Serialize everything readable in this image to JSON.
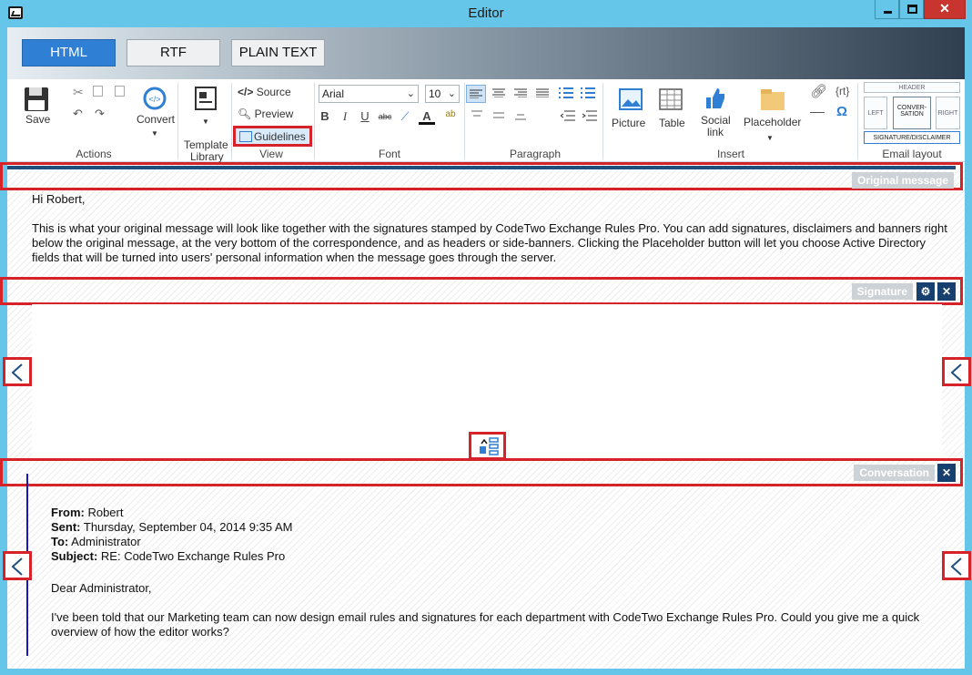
{
  "window": {
    "title": "Editor",
    "minimize_glyph": "",
    "maximize_glyph": "",
    "close_glyph": "✕"
  },
  "format_tabs": [
    {
      "label": "HTML",
      "active": true
    },
    {
      "label": "RTF",
      "active": false
    },
    {
      "label": "PLAIN TEXT",
      "active": false
    }
  ],
  "ribbon": {
    "actions": {
      "save": "Save",
      "convert": "Convert",
      "label": "Actions"
    },
    "template": {
      "label_line1": "Template",
      "label_line2": "Library"
    },
    "view": {
      "source": "Source",
      "preview": "Preview",
      "guidelines": "Guidelines",
      "label": "View"
    },
    "font": {
      "family": "Arial",
      "size": "10",
      "label": "Font"
    },
    "paragraph": {
      "label": "Paragraph"
    },
    "insert": {
      "picture": "Picture",
      "table": "Table",
      "social_line1": "Social",
      "social_line2": "link",
      "placeholder": "Placeholder",
      "rt": "{rt}",
      "omega": "Ω",
      "label": "Insert"
    },
    "email_layout": {
      "header": "HEADER",
      "left": "LEFT",
      "conversation_line1": "CONVER-",
      "conversation_line2": "SATION",
      "right": "RIGHT",
      "sig": "SIGNATURE/DISCLAIMER",
      "label": "Email layout"
    }
  },
  "sections": {
    "original_message": "Original message",
    "signature": "Signature",
    "conversation": "Conversation"
  },
  "original": {
    "greeting": "Hi Robert,",
    "line1": "This is what your original message will look like together with the signatures stamped by CodeTwo Exchange Rules Pro. You can add signatures, disclaimers and banners right",
    "line2": "below the original message, at the very bottom of the correspondence, and as headers or side-banners. Clicking the Placeholder button will let you choose Active Directory",
    "line3": "fields that will be turned into users' personal information when the message goes through the server."
  },
  "conversation": {
    "from_label": "From:",
    "from_value": " Robert",
    "sent_label": "Sent:",
    "sent_value": " Thursday, September 04, 2014 9:35 AM",
    "to_label": "To:",
    "to_value": " Administrator",
    "subject_label": "Subject:",
    "subject_value": " RE: CodeTwo Exchange Rules Pro",
    "greeting": "Dear Administrator,",
    "line1": "I've been told that our Marketing team can now design email rules and signatures for each department with CodeTwo Exchange Rules Pro. Could you give me a quick",
    "line2": "overview of how the editor works?"
  },
  "colors": {
    "titlebar": "#66c6ea",
    "accent": "#2f7fd4",
    "highlight_red": "#d6232a",
    "dark_button": "#17406e"
  }
}
